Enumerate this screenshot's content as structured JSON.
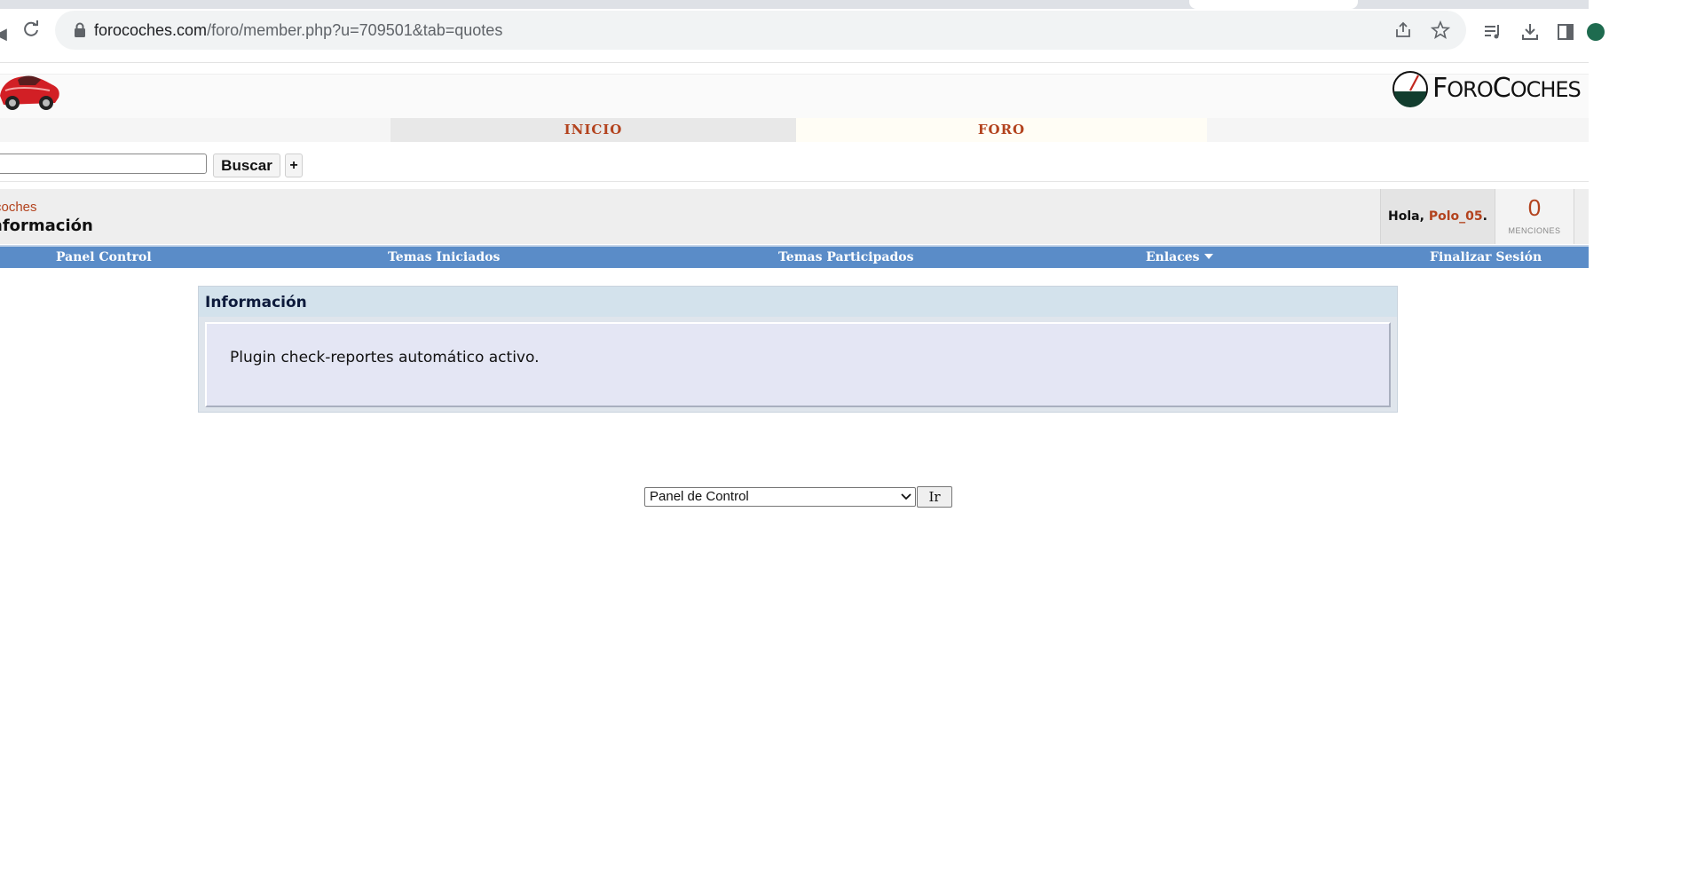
{
  "browser": {
    "url_host": "forocoches.com",
    "url_path": "/foro/member.php?u=709501&tab=quotes",
    "icons": [
      "back-icon",
      "reload-icon",
      "lock-icon",
      "share-icon",
      "star-icon",
      "media-icon",
      "download-icon",
      "sidepanel-icon",
      "profile-icon"
    ]
  },
  "header": {
    "logo_text_big": "F",
    "logo_text": "ORO",
    "logo_text_big2": "C",
    "logo_text2": "OCHES"
  },
  "topnav": {
    "tabs": [
      {
        "label": "INICIO"
      },
      {
        "label": "FORO"
      }
    ]
  },
  "search": {
    "value": "",
    "button_label": "Buscar",
    "plus_label": "+"
  },
  "breadcrumb": {
    "link": "coches",
    "title": "nformación"
  },
  "user": {
    "greeting": "Hola, ",
    "username": "Polo_05",
    "suffix": ".",
    "mentions_count": "0",
    "mentions_label": "MENCIONES"
  },
  "bluenav": {
    "items": [
      {
        "label": "Panel Control"
      },
      {
        "label": "Temas Iniciados"
      },
      {
        "label": "Temas Participados"
      },
      {
        "label": "Enlaces"
      },
      {
        "label": "Finalizar Sesión"
      }
    ]
  },
  "info": {
    "title": "Información",
    "message": "Plugin check-reportes automático activo."
  },
  "jump": {
    "selected": "Panel de Control",
    "go_label": "Ir"
  },
  "colors": {
    "accent": "#b3431e",
    "nav_blue": "#5a8cc8"
  }
}
